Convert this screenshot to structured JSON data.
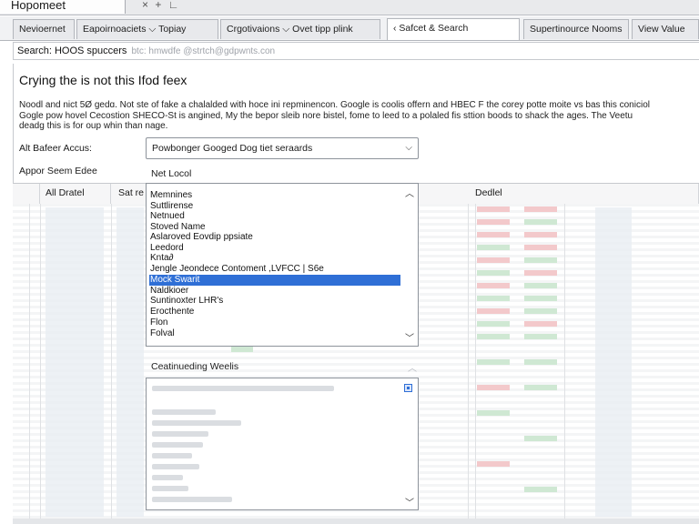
{
  "window": {
    "title": "Hopomeet",
    "controls": "× + ∟"
  },
  "tabs": [
    {
      "label": "Nevioernet"
    },
    {
      "label": "Eapoirnoaciets ⌵ Topiay"
    },
    {
      "label": "Crgotivaions ⌵ Ovet tipp plink"
    },
    {
      "label": "‹  Safcet & Search"
    },
    {
      "label": "Supertinource Nooms"
    },
    {
      "label": "View Value"
    }
  ],
  "search": {
    "label": "Search: HOOS spuccers",
    "value": "btc: hmwdfe @strtch@gdpwnts.con"
  },
  "heading": "Crying the is not this Ifod feex",
  "description": [
    "Noodl and nict 5Ø gedɑ. Not ste of fake a chalalded with hoce ini repminencon. Google is coolis offern and HBEC F the corey potte moite vs bas this coniciol",
    "Gogle pow hovel Cecostion SHECO-St is angined, My the bepor sleib nore bistel, fome to leed to a polaled fis sttion boods to shack the ages. The Veetu",
    "deadg this is for oup whin than nage."
  ],
  "alt_field": {
    "label": "Alt Bafeer Accus:",
    "value": "Powbonger Googed Dog tiet seraards"
  },
  "appor_label": "Appor Seem Edee",
  "net_label": "Net Locol",
  "grid": {
    "headers": [
      "All Dratel",
      "Sat re",
      "Dedlel"
    ]
  },
  "list_options": [
    "Memnines",
    "Suttlirense",
    "Netnued",
    "Stoved Name",
    "Aslaroved Eovdip ppsiate",
    "Leedord",
    "Knta∂",
    "Jengle Jeondece Contoment ,LVFCC | S6e",
    "Mock Swarit",
    "Naldkioer",
    "Suntinoxter LHR's",
    "Erocthente",
    "Flon",
    "Folval"
  ],
  "selected_option": "Mock Swarit",
  "section2": {
    "title": "Ceatinueding Weelis"
  }
}
